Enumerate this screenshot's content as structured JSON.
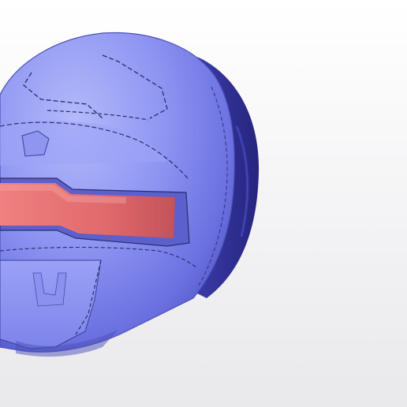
{
  "scene": {
    "subject": "helmet-3d-model",
    "colors": {
      "background_top": "#ffffff",
      "background_bottom": "#e9e9ec",
      "shell_light": "#a7aef8",
      "shell_mid": "#6f76e6",
      "shell_dark": "#3d3fa6",
      "shell_back": "#2b2a8c",
      "visor": "#e06a6c",
      "visor_dark": "#a84655",
      "outline": "#1c1c3a"
    }
  }
}
